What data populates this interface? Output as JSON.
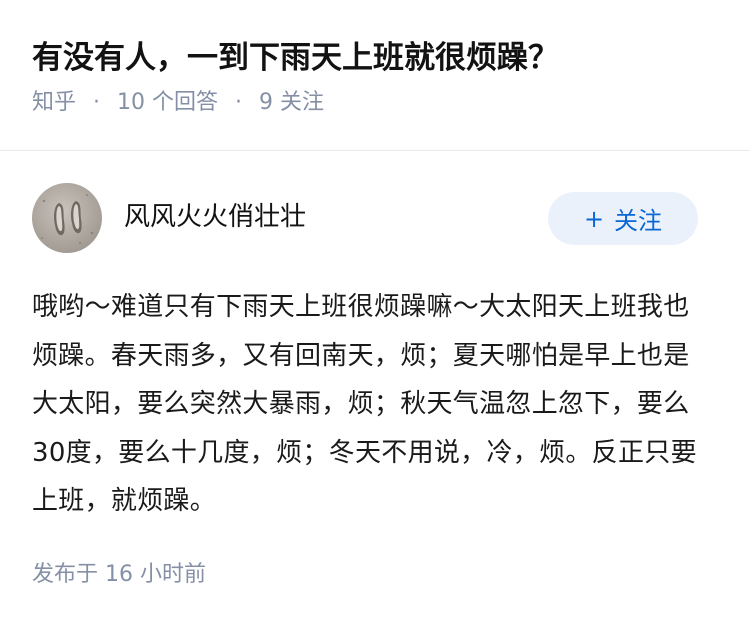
{
  "question": {
    "title": "有没有人，一到下雨天上班就很烦躁？",
    "source": "知乎",
    "separator": "·",
    "answers": "10 个回答",
    "followers": "9 关注"
  },
  "author": {
    "name": "风风火火俏壮壮",
    "avatar_icon": "footprints-avatar-icon"
  },
  "follow_button": {
    "icon": "plus-icon",
    "icon_glyph": "+",
    "label": "关注",
    "color": "#0b67d3",
    "background": "#ebf1fb"
  },
  "answer": {
    "content": "哦哟～难道只有下雨天上班很烦躁嘛～大太阳天上班我也烦躁。春天雨多，又有回南天，烦；夏天哪怕是早上也是大太阳，要么突然大暴雨，烦；秋天气温忽上忽下，要么30度，要么十几度，烦；冬天不用说，冷，烦。反正只要上班，就烦躁。",
    "published": "发布于  16 小时前"
  }
}
